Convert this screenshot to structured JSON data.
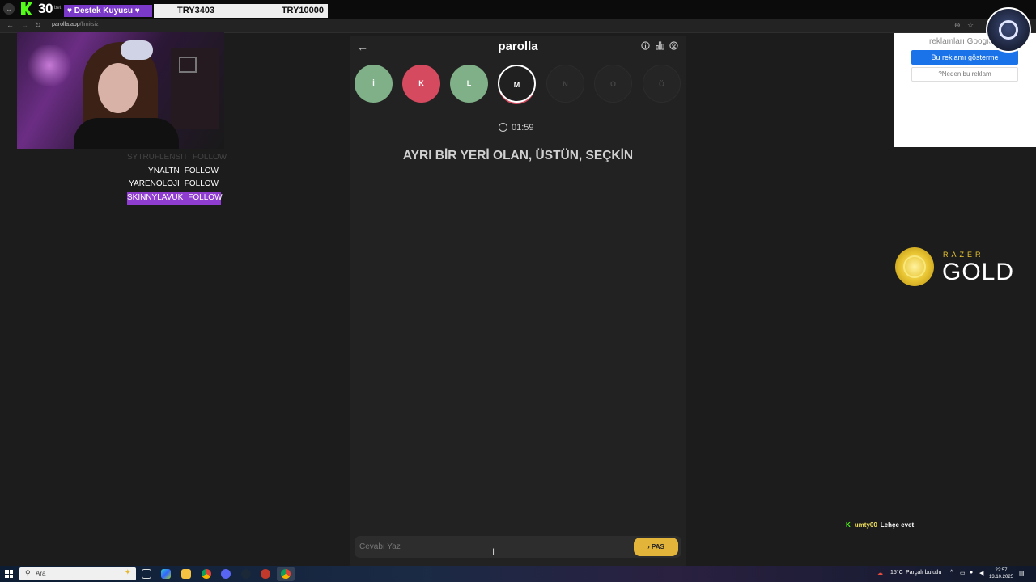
{
  "stream_overlay": {
    "follower_count": "30",
    "tiny_label": "bet",
    "destek_label": "♥ Destek Kuyusu ♥",
    "goal_current": "TRY3403",
    "goal_target": "TRY10000"
  },
  "browser": {
    "url_host": "parolla.app",
    "url_path": "/limitsiz"
  },
  "follows": [
    {
      "name": "SYTRUFLENSIT",
      "action": "FOLLOW"
    },
    {
      "name": "YNALTN",
      "action": "FOLLOW"
    },
    {
      "name": "YARENOLOJI",
      "action": "FOLLOW"
    },
    {
      "name": "SKINNYLAVUK",
      "action": "FOLLOW"
    }
  ],
  "game": {
    "brand": "parolla",
    "letters": [
      {
        "char": "İ",
        "state": "correct"
      },
      {
        "char": "K",
        "state": "wrong"
      },
      {
        "char": "L",
        "state": "correct"
      },
      {
        "char": "M",
        "state": "current"
      },
      {
        "char": "N",
        "state": "pending"
      },
      {
        "char": "O",
        "state": "pending"
      },
      {
        "char": "Ö",
        "state": "pending"
      }
    ],
    "timer": "01:59",
    "question": "AYRI BİR YERİ OLAN, ÜSTÜN, SEÇKİN",
    "answer_placeholder": "Cevabı Yaz",
    "pass_label": "PAS",
    "colors": {
      "correct": "#7fb087",
      "wrong": "#d64a5f",
      "pass": "#e3b43a"
    }
  },
  "ad": {
    "top_text": "reklamları Google",
    "hide_button": "Bu reklamı gösterme",
    "why_button": "?Neden bu reklam"
  },
  "razer": {
    "brand": "RAZER",
    "product": "GOLD"
  },
  "chat": {
    "user": "umty00",
    "message": "Lehçe evet"
  },
  "taskbar": {
    "search_placeholder": "Ara",
    "weather": "15°C",
    "weather_desc": "Parçalı bulutlu",
    "time": "22:57",
    "date": "13.10.2025"
  }
}
